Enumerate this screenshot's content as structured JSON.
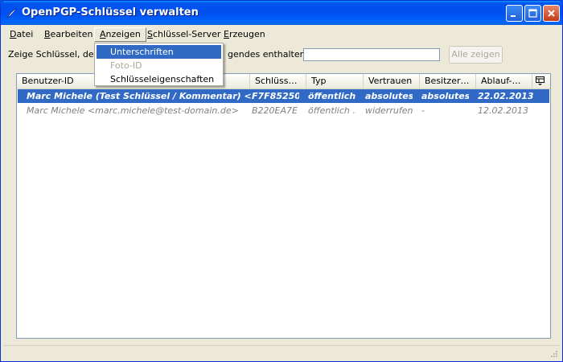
{
  "window": {
    "title": "OpenPGP-Schlüssel verwalten"
  },
  "menubar": {
    "items": [
      {
        "label": "Datei",
        "accel": "D"
      },
      {
        "label": "Bearbeiten",
        "accel": "B"
      },
      {
        "label": "Anzeigen",
        "accel": "A"
      },
      {
        "label": "Schlüssel-Server",
        "accel": "S"
      },
      {
        "label": "Erzeugen",
        "accel": "E"
      }
    ]
  },
  "view_menu": {
    "items": [
      {
        "label": "Unterschriften",
        "state": "highlighted"
      },
      {
        "label": "Foto-ID",
        "state": "disabled"
      },
      {
        "label": "Schlüsseleigenschaften",
        "state": "normal"
      }
    ]
  },
  "filter": {
    "label_start": "Zeige Schlüssel, derer",
    "label_end": "gendes enthalten:",
    "value": "",
    "show_all_label": "Alle zeigen"
  },
  "key_list": {
    "columns": [
      "Benutzer-ID",
      "Schlüss…",
      "Typ",
      "Vertrauen",
      "Besitzer…",
      "Ablauf-…"
    ],
    "rows": [
      {
        "cells": [
          "Marc Michele (Test Schlüssel / Kommentar) <…",
          "F7F85250",
          "öffentlich …",
          "absolutes…",
          "absolutes…",
          "22.02.2013"
        ],
        "selected": true,
        "revoked": false
      },
      {
        "cells": [
          "Marc Michele <marc.michele@test-domain.de>",
          "B220EA7E",
          "öffentlich …",
          "widerrufen",
          "-",
          "12.02.2013"
        ],
        "selected": false,
        "revoked": true
      }
    ]
  },
  "icons": {
    "app": "pen-icon",
    "column_picker": "column-picker-icon",
    "minimize": "minimize-icon",
    "maximize": "maximize-icon",
    "close": "close-icon"
  },
  "colors": {
    "title_bar": "#0053ee",
    "selection": "#316ac5",
    "window_face": "#ece9d8"
  }
}
